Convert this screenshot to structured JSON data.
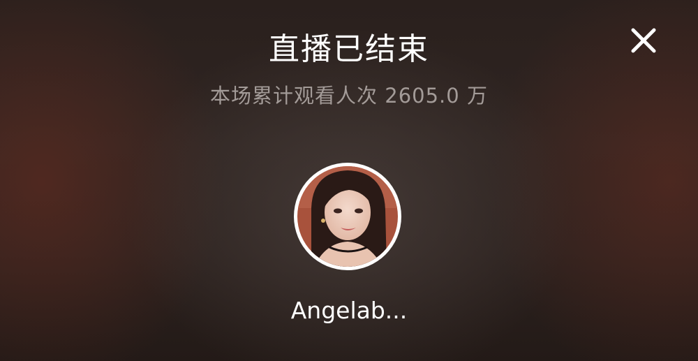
{
  "header": {
    "title": "直播已结束",
    "close_icon": "close-icon"
  },
  "stats": {
    "total_views_text": "本场累计观看人次 2605.0 万"
  },
  "host": {
    "avatar": "avatar-photo",
    "username": "Angelab..."
  },
  "colors": {
    "background": "#2c221f",
    "text_primary": "#ffffff",
    "text_secondary": "#a39b98",
    "avatar_border": "#ffffff"
  }
}
